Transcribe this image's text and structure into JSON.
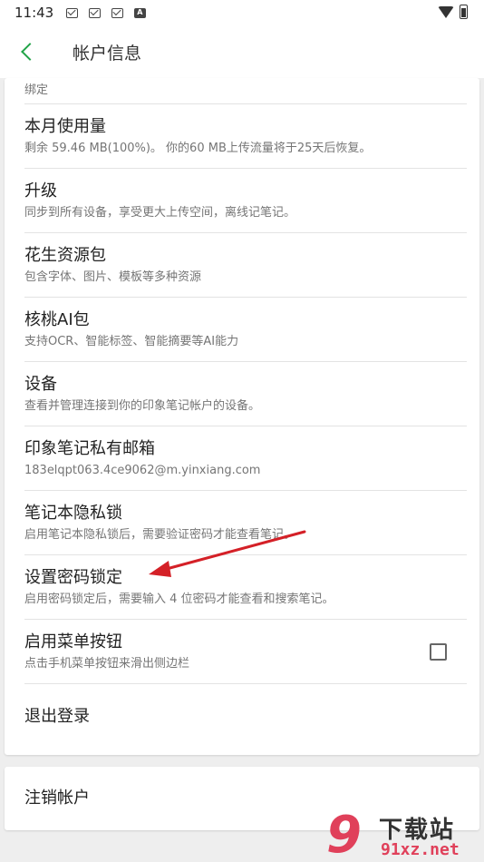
{
  "status_bar": {
    "time": "11:43",
    "icons": [
      "mail-icon",
      "mail-icon",
      "mail-icon",
      "a-icon",
      "wifi-icon",
      "battery-icon"
    ],
    "a_label": "A"
  },
  "app_bar": {
    "title": "帐户信息",
    "back_icon": "chevron-left-icon",
    "accent_color": "#21a448"
  },
  "settings": {
    "partial_top": "绑定",
    "items": [
      {
        "title": "本月使用量",
        "subtitle": "剩余 59.46 MB(100%)。 你的60 MB上传流量将于25天后恢复。"
      },
      {
        "title": "升级",
        "subtitle": "同步到所有设备，享受更大上传空间，离线记笔记。"
      },
      {
        "title": "花生资源包",
        "subtitle": "包含字体、图片、模板等多种资源"
      },
      {
        "title": "核桃AI包",
        "subtitle": "支持OCR、智能标签、智能摘要等AI能力"
      },
      {
        "title": "设备",
        "subtitle": "查看并管理连接到你的印象笔记帐户的设备。"
      },
      {
        "title": "印象笔记私有邮箱",
        "subtitle": "183elqpt063.4ce9062@m.yinxiang.com"
      },
      {
        "title": "笔记本隐私锁",
        "subtitle": "启用笔记本隐私锁后，需要验证密码才能查看笔记。"
      },
      {
        "title": "设置密码锁定",
        "subtitle": "启用密码锁定后，需要输入 4 位密码才能查看和搜索笔记。"
      },
      {
        "title": "启用菜单按钮",
        "subtitle": "点击手机菜单按钮来滑出侧边栏",
        "checkbox_checked": false
      }
    ],
    "sign_out": "退出登录",
    "delete_account": "注销帐户"
  },
  "annotation": {
    "color": "#d42027"
  },
  "watermark": {
    "top_text": "下载站",
    "bottom_text": "91xz.net",
    "logo_text": "9"
  }
}
